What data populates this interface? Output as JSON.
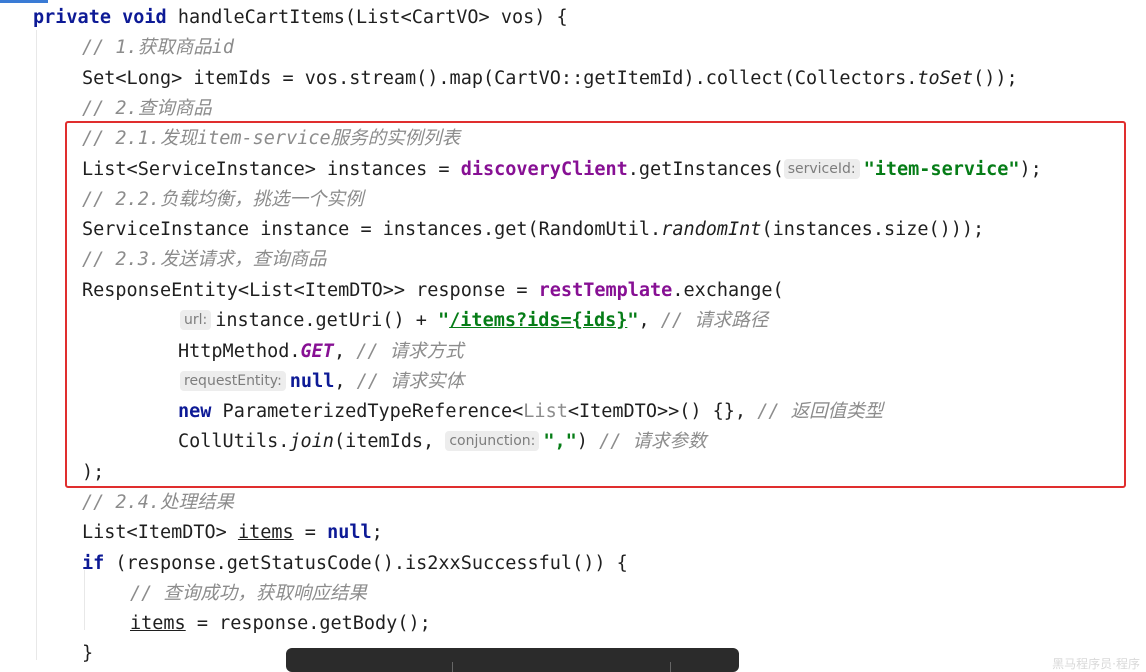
{
  "code": {
    "method_sig": [
      "private",
      "void",
      "handleCartItems(List<CartVO> vos) {"
    ],
    "c1": "// 1.获取商品id",
    "l_set": [
      "Set<Long> itemIds = vos.stream().map(CartVO::getItemId).collect(Collectors.",
      "toSet",
      "());"
    ],
    "c2": "// 2.查询商品",
    "c21": "// 2.1.发现item-service服务的实例列表",
    "l_inst": [
      "List<ServiceInstance> instances = ",
      "discoveryClient",
      ".getInstances(",
      "serviceId:",
      "\"item-service\"",
      ");"
    ],
    "c22": "// 2.2.负载均衡，挑选一个实例",
    "l_one": [
      "ServiceInstance instance = instances.get(RandomUtil.",
      "randomInt",
      "(instances.size()));"
    ],
    "c23": "// 2.3.发送请求，查询商品",
    "l_resp": [
      "ResponseEntity<List<ItemDTO>> response = ",
      "restTemplate",
      ".exchange("
    ],
    "l_url": [
      "url:",
      "instance.getUri() + ",
      "\"",
      "/items?ids={ids}",
      "\"",
      ", ",
      "// 请求路径"
    ],
    "l_get": [
      "HttpMethod.",
      "GET",
      ", ",
      "// 请求方式"
    ],
    "l_ent": [
      "requestEntity:",
      "null",
      ", ",
      "// 请求实体"
    ],
    "l_new": [
      "new",
      " ParameterizedTypeReference<",
      "List",
      "<ItemDTO>>() {}, ",
      "// 返回值类型"
    ],
    "l_join": [
      "CollUtils.",
      "join",
      "(itemIds, ",
      "conjunction:",
      "\",\"",
      ") ",
      "// 请求参数"
    ],
    "l_close": ");",
    "c24": "// 2.4.处理结果",
    "l_items": [
      "List<ItemDTO> ",
      "items",
      " = ",
      "null",
      ";"
    ],
    "l_if": [
      "if",
      " (response.getStatusCode().is2xxSuccessful()) {"
    ],
    "c_ok": "// 查询成功，获取响应结果",
    "l_body": [
      "items",
      " = response.getBody();"
    ],
    "l_end": "}"
  },
  "colors": {
    "keyword": "#0d1a96",
    "comment": "#8c8c8c",
    "field": "#871094",
    "string": "#067d17",
    "highlight_box": "#e02e2e"
  },
  "watermark": "黑马程序员·程序"
}
